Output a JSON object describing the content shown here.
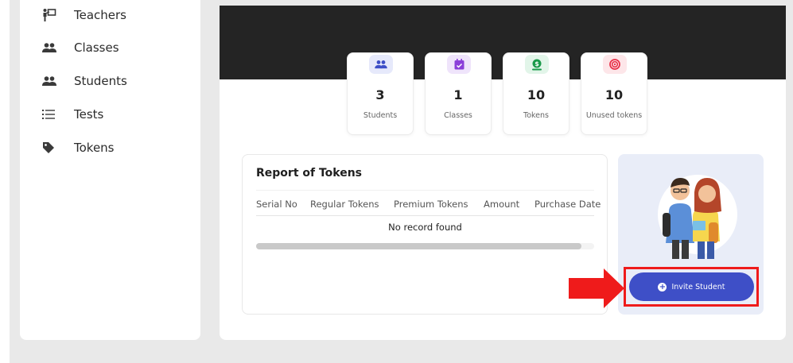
{
  "sidebar": {
    "items": [
      {
        "label": "Teachers",
        "icon": "teacher-board-icon"
      },
      {
        "label": "Classes",
        "icon": "group-icon"
      },
      {
        "label": "Students",
        "icon": "group-icon"
      },
      {
        "label": "Tests",
        "icon": "list-icon"
      },
      {
        "label": "Tokens",
        "icon": "tag-icon"
      }
    ]
  },
  "stats": [
    {
      "value": "3",
      "caption": "Students",
      "icon": "students-icon",
      "color": "#3e4fc7",
      "bg": "#e6e9fb"
    },
    {
      "value": "1",
      "caption": "Classes",
      "icon": "calendar-check-icon",
      "color": "#8b3fd9",
      "bg": "#efe4fb"
    },
    {
      "value": "10",
      "caption": "Tokens",
      "icon": "money-icon",
      "color": "#1a9a4a",
      "bg": "#e2f5e9"
    },
    {
      "value": "10",
      "caption": "Unused tokens",
      "icon": "target-icon",
      "color": "#e8334a",
      "bg": "#fde6e9"
    }
  ],
  "report": {
    "title": "Report of Tokens",
    "columns": [
      "Serial No",
      "Regular Tokens",
      "Premium Tokens",
      "Amount",
      "Purchase Date"
    ],
    "empty_text": "No record found"
  },
  "invite": {
    "button_label": "Invite Student",
    "highlight_color": "#ef1b1b",
    "button_color": "#3e4fc7"
  },
  "colors": {
    "hero": "#242424",
    "accent": "#3e4fc7",
    "arrow": "#ef1b1b"
  }
}
